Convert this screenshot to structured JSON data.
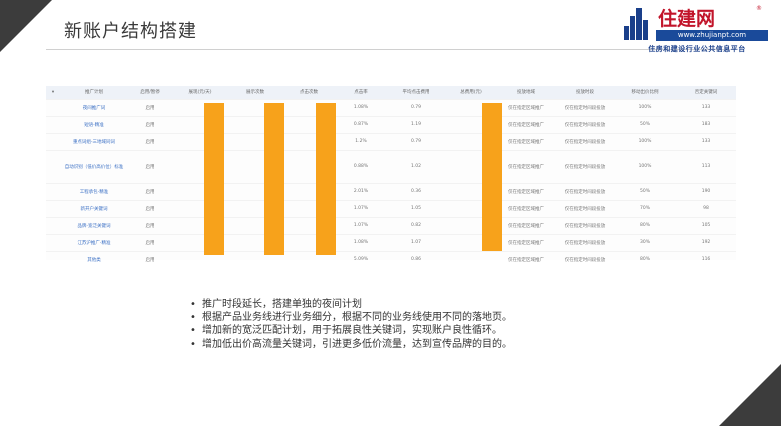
{
  "slide": {
    "title": "新账户结构搭建"
  },
  "logo": {
    "brand": "住建网",
    "registered": "®",
    "url": "www.zhujianpt.com",
    "tagline": "住房和建设行业公共信息平台",
    "colors": {
      "brand": "#c2152b",
      "blue": "#1a4a9a"
    }
  },
  "table": {
    "headers": [
      "",
      "推广计划",
      "启用/暂停",
      "展现(元/天)",
      "展示次数",
      "点击次数",
      "点击率",
      "平均点击费用",
      "总费用(元)",
      "投放地域",
      "投放时段",
      "移动出价比例",
      "否定关键词"
    ],
    "rows": [
      {
        "name": "夜间推广词",
        "status": "启用",
        "ctr": "1.08%",
        "avg_cost": "0.79",
        "region": "仅在指定区域推广",
        "period": "仅在指定时间段投放",
        "mobile": "100%",
        "negatives": "133"
      },
      {
        "name": "短语-精准",
        "status": "启用",
        "ctr": "0.87%",
        "avg_cost": "1.19",
        "region": "仅在指定区域推广",
        "period": "仅在指定时间段投放",
        "mobile": "50%",
        "negatives": "183"
      },
      {
        "name": "重点词组-三地域同词",
        "status": "启用",
        "ctr": "1.2%",
        "avg_cost": "0.79",
        "region": "仅在指定区域推广",
        "period": "仅在指定时间段投放",
        "mobile": "100%",
        "negatives": "133"
      },
      {
        "name": "自动识别（低价高价位）标准",
        "status": "启用",
        "ctr": "0.88%",
        "avg_cost": "1.02",
        "region": "仅在指定区域推广",
        "period": "仅在指定时间段投放",
        "mobile": "100%",
        "negatives": "113"
      },
      {
        "name": "工程承包-精准",
        "status": "启用",
        "ctr": "2.01%",
        "avg_cost": "0.36",
        "region": "仅在指定区域推广",
        "period": "仅在指定时间段投放",
        "mobile": "50%",
        "negatives": "190"
      },
      {
        "name": "新开户关键词",
        "status": "启用",
        "ctr": "1.07%",
        "avg_cost": "1.05",
        "region": "仅在指定区域推广",
        "period": "仅在指定时间段投放",
        "mobile": "70%",
        "negatives": "98"
      },
      {
        "name": "品牌-宽泛关键词",
        "status": "启用",
        "ctr": "1.07%",
        "avg_cost": "0.82",
        "region": "仅在指定区域推广",
        "period": "仅在指定时间段投放",
        "mobile": "80%",
        "negatives": "105"
      },
      {
        "name": "江苏沪推广-精准",
        "status": "启用",
        "ctr": "1.08%",
        "avg_cost": "1.07",
        "region": "仅在指定区域推广",
        "period": "仅在指定时间段投放",
        "mobile": "30%",
        "negatives": "192"
      },
      {
        "name": "其他类",
        "status": "启用",
        "ctr": "5.09%",
        "avg_cost": "0.86",
        "region": "仅在指定区域推广",
        "period": "仅在指定时间段投放",
        "mobile": "80%",
        "negatives": "116"
      }
    ],
    "redaction_color": "#f7a21b"
  },
  "bullets": [
    "推广时段延长，搭建单独的夜间计划",
    "根据产品业务线进行业务细分，根据不同的业务线使用不同的落地页。",
    "增加新的宽泛匹配计划，用于拓展良性关键词，实现账户良性循环。",
    "增加低出价高流量关键词，引进更多低价流量，达到宣传品牌的目的。"
  ],
  "colors": {
    "accent_dark": "#3c3c3c",
    "link": "#3a6fc4"
  }
}
